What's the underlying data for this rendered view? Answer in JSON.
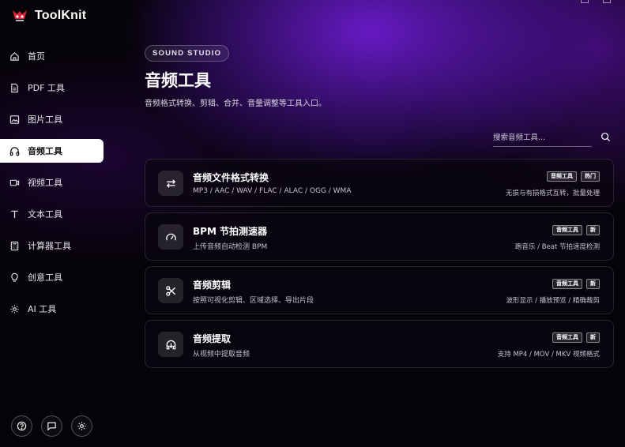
{
  "app": {
    "name": "ToolKnit"
  },
  "sidebar": {
    "items": [
      {
        "label": "首页",
        "icon": "home-icon"
      },
      {
        "label": "PDF 工具",
        "icon": "document-icon"
      },
      {
        "label": "图片工具",
        "icon": "image-icon"
      },
      {
        "label": "音频工具",
        "icon": "headphones-icon",
        "active": true
      },
      {
        "label": "视频工具",
        "icon": "video-icon"
      },
      {
        "label": "文本工具",
        "icon": "text-icon"
      },
      {
        "label": "计算器工具",
        "icon": "calculator-icon"
      },
      {
        "label": "创意工具",
        "icon": "lightbulb-icon"
      },
      {
        "label": "AI 工具",
        "icon": "gear-icon"
      }
    ],
    "bottom_buttons": [
      "help-icon",
      "feedback-icon",
      "settings-icon"
    ]
  },
  "header": {
    "badge": "SOUND STUDIO",
    "title": "音频工具",
    "subtitle": "音频格式转换、剪辑、合并、音量调整等工具入口。"
  },
  "search": {
    "placeholder": "搜索音频工具..."
  },
  "cards": [
    {
      "icon": "swap-arrows-icon",
      "title": "音频文件格式转换",
      "desc": "MP3 / AAC / WAV / FLAC / ALAC / OGG / WMA",
      "tags": [
        "音频工具",
        "热门"
      ],
      "note": "无损与有损格式互转，批量处理"
    },
    {
      "icon": "gauge-icon",
      "title": "BPM 节拍测速器",
      "desc": "上传音频自动检测 BPM",
      "tags": [
        "音频工具",
        "新"
      ],
      "note": "跑音乐 / Beat 节拍速度检测"
    },
    {
      "icon": "scissors-icon",
      "title": "音频剪辑",
      "desc": "按照可视化剪辑、区域选择、导出片段",
      "tags": [
        "音频工具",
        "新"
      ],
      "note": "波形显示 / 播放预览 / 精确裁剪"
    },
    {
      "icon": "extract-audio-icon",
      "title": "音频提取",
      "desc": "从视频中提取音频",
      "tags": [
        "音频工具",
        "新"
      ],
      "note": "支持 MP4 / MOV / MKV 视频格式"
    }
  ]
}
